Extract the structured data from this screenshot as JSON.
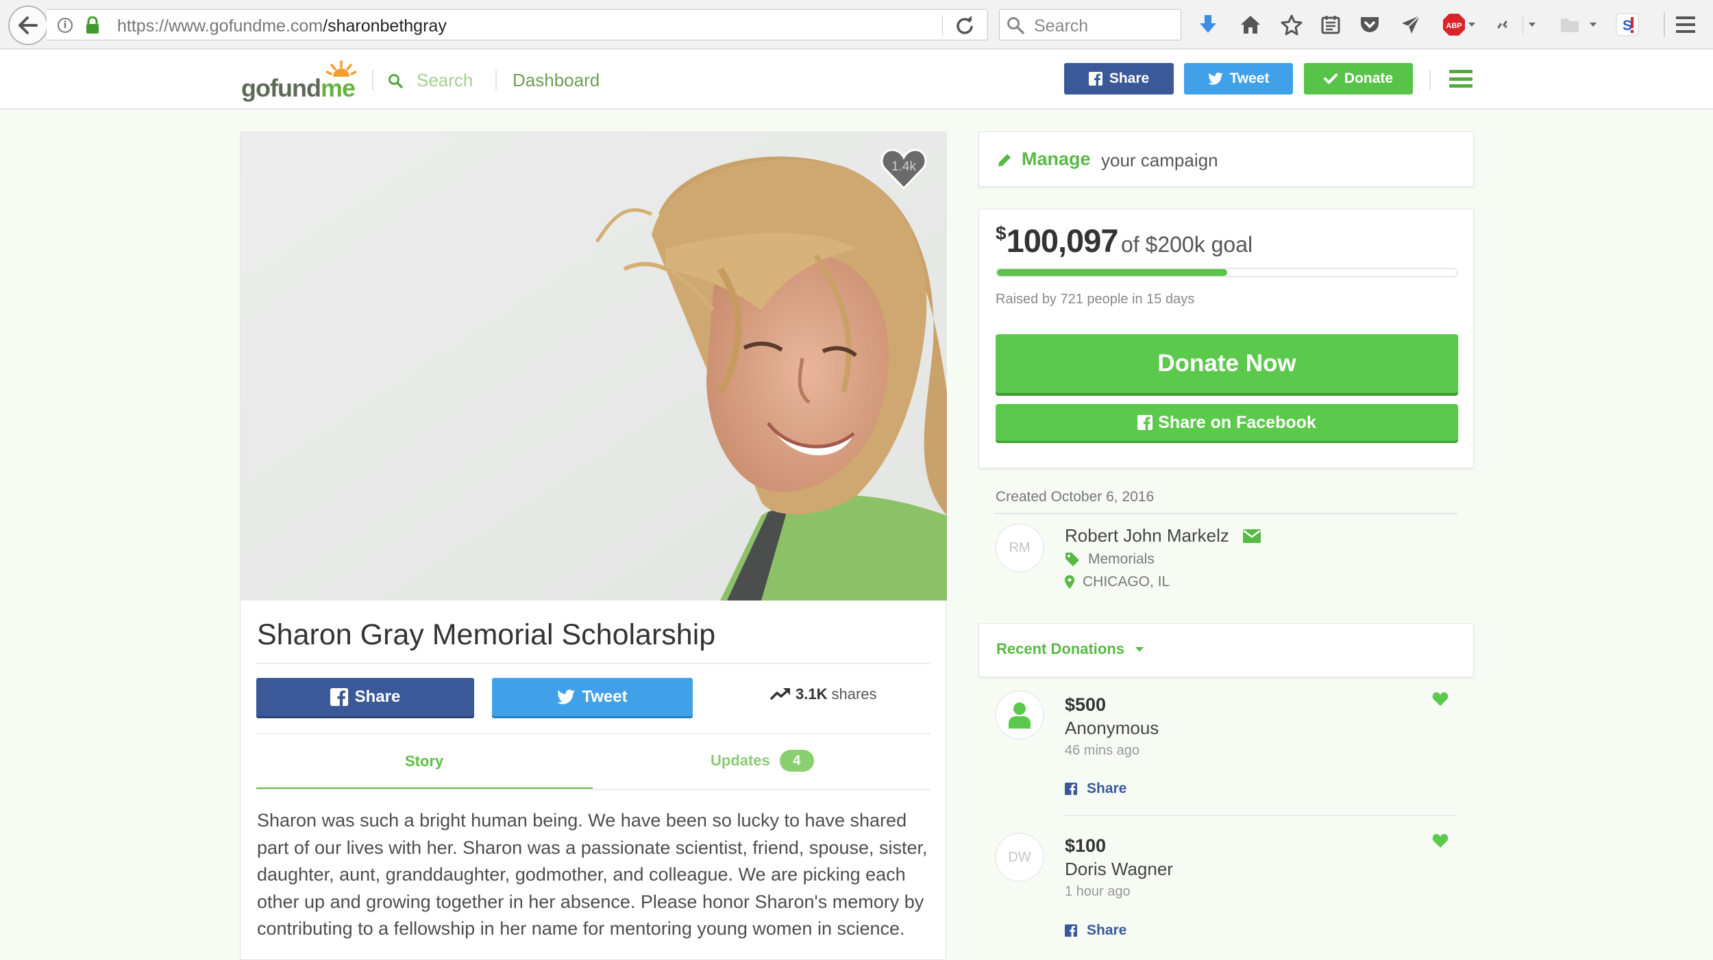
{
  "browser": {
    "url_host": "https://www.gofundme.com",
    "url_path": "/sharonbethgray",
    "search_placeholder": "Search",
    "toolbar_icons": [
      "download-icon",
      "home-icon",
      "bookmark-star-icon",
      "reading-list-icon",
      "pocket-icon",
      "send-icon",
      "adblock-icon",
      "extension-icon",
      "folder-icon",
      "sj-extension-icon",
      "menu-icon"
    ],
    "adblock_label": "ABP"
  },
  "header": {
    "logo_part1": "gofund",
    "logo_part2": "me",
    "search_label": "Search",
    "dashboard_label": "Dashboard",
    "share_label": "Share",
    "tweet_label": "Tweet",
    "donate_label": "Donate"
  },
  "campaign": {
    "hearts": "1.4k",
    "title": "Sharon Gray Memorial Scholarship",
    "share_label": "Share",
    "tweet_label": "Tweet",
    "shares_count": "3.1K",
    "shares_label": "shares",
    "tabs": {
      "story": "Story",
      "updates": "Updates",
      "updates_count": "4"
    },
    "story": "Sharon was such a bright human being. We have been so lucky to have shared part of our lives with her. Sharon was a passionate scientist, friend, spouse, sister, daughter, aunt, granddaughter, godmother, and colleague. We are picking each other up and growing together in her absence. Please honor Sharon's memory by contributing to a fellowship in her name for mentoring young women in science."
  },
  "sidebar": {
    "manage_label": "Manage",
    "manage_suffix": "your campaign",
    "amount_currency": "$",
    "amount_raised": "100,097",
    "goal_text": "of $200k goal",
    "progress_fraction": 0.5,
    "raised_text": "Raised by 721 people in 15 days",
    "donate_now_label": "Donate Now",
    "share_facebook_label": "Share on Facebook",
    "created_text": "Created October 6, 2016",
    "organizer": {
      "initials": "RM",
      "name": "Robert John Markelz",
      "category": "Memorials",
      "location": "CHICAGO, IL"
    },
    "recent_donations_label": "Recent Donations",
    "donations": [
      {
        "amount": "$500",
        "name": "Anonymous",
        "time": "46 mins ago",
        "share_label": "Share"
      },
      {
        "initials": "DW",
        "amount": "$100",
        "name": "Doris Wagner",
        "time": "1 hour ago",
        "share_label": "Share"
      }
    ]
  },
  "colors": {
    "brand_green": "#5bc94b",
    "facebook_blue": "#3b5998",
    "twitter_blue": "#41a1e8",
    "page_background": "#f6fbf4"
  }
}
